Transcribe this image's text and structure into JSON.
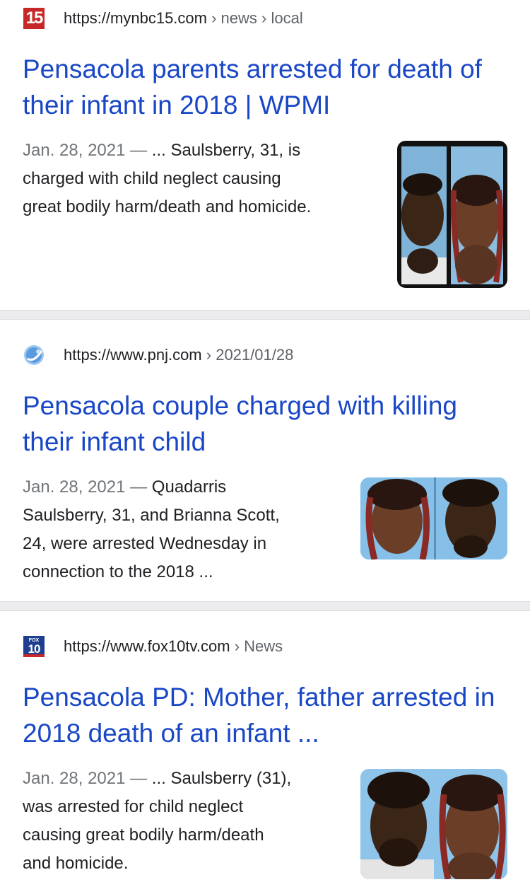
{
  "results": [
    {
      "site_icon": "nbc15-logo-icon",
      "site_icon_text": "15",
      "url": "https://mynbc15.com",
      "breadcrumb": "› news › local",
      "title": "Pensacola parents arrested for death of their infant in 2018 | WPMI",
      "date": "Jan. 28, 2021",
      "dash": " — ",
      "snippet_lines": [
        "... Saulsberry, 31, is",
        "charged with child neglect causing",
        "great bodily harm/death and homicide."
      ],
      "thumbnail": "mugshots-two-people-thumbnail"
    },
    {
      "site_icon": "pnj-globe-icon",
      "url": "https://www.pnj.com",
      "breadcrumb": "› 2021/01/28",
      "title": "Pensacola couple charged with killing their infant child",
      "date": "Jan. 28, 2021",
      "dash": " — ",
      "snippet_lines": [
        "Quadarris",
        "Saulsberry, 31, and Brianna Scott,",
        "24, were arrested Wednesday in",
        "connection to the 2018 ..."
      ],
      "thumbnail": "mugshots-two-people-thumbnail"
    },
    {
      "site_icon": "fox10-logo-icon",
      "site_icon_text": "10",
      "site_icon_small": "FOX",
      "url": "https://www.fox10tv.com",
      "breadcrumb": "› News",
      "title": "Pensacola PD: Mother, father arrested in 2018 death of an infant ...",
      "date": "Jan. 28, 2021",
      "dash": " — ",
      "snippet_lines": [
        "... Saulsberry (31),",
        "was arrested for child neglect",
        "causing great bodily harm/death",
        "and homicide."
      ],
      "thumbnail": "mugshots-two-people-thumbnail"
    }
  ],
  "colors": {
    "title_link": "#1a47c6",
    "text": "#202124",
    "muted": "#70757a",
    "separator": "#ececef"
  }
}
